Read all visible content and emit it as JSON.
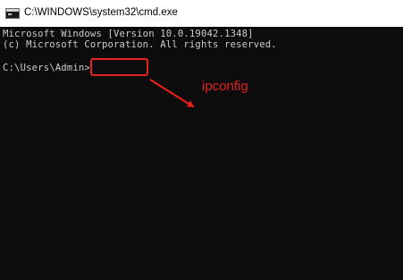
{
  "window": {
    "title": "C:\\WINDOWS\\system32\\cmd.exe"
  },
  "console": {
    "lines": [
      "Microsoft Windows [Version 10.0.19042.1348]",
      "(c) Microsoft Corporation. All rights reserved."
    ],
    "prompt": "C:\\Users\\Admin>",
    "input_value": ""
  },
  "annotation": {
    "text": "ipconfig",
    "color": "#e8201a"
  },
  "colors": {
    "console_bg": "#0c0c0c",
    "console_text": "#cccccc",
    "annotation_red": "#e8201a"
  },
  "icons": {
    "title_icon": "cmd-app-icon"
  }
}
